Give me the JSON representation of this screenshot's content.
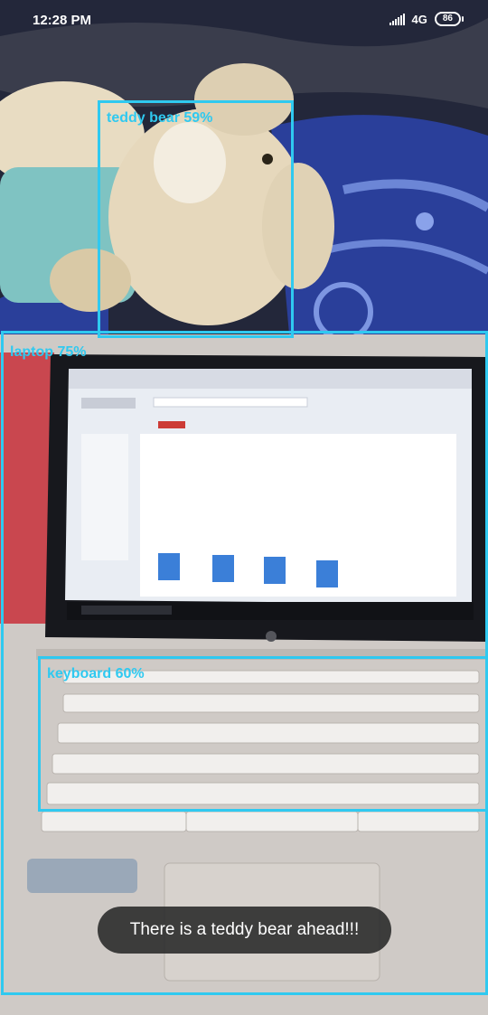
{
  "status_bar": {
    "time": "12:28 PM",
    "network": "4G",
    "battery": "86"
  },
  "detections": [
    {
      "label": "teddy bear 59%"
    },
    {
      "label": "laptop 75%"
    },
    {
      "label": "keyboard 60%"
    }
  ],
  "toast": {
    "message": "There is a teddy bear ahead!!!"
  },
  "colors": {
    "detection_box": "#2fc9f0",
    "toast_bg": "#282828"
  }
}
